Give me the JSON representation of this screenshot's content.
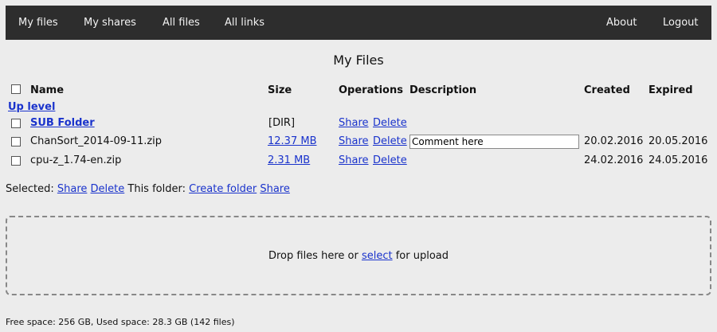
{
  "nav": {
    "left": [
      {
        "label": "My files"
      },
      {
        "label": "My shares"
      },
      {
        "label": "All files"
      },
      {
        "label": "All links"
      }
    ],
    "right": [
      {
        "label": "About"
      },
      {
        "label": "Logout"
      }
    ]
  },
  "title": "My Files",
  "table": {
    "headers": {
      "name": "Name",
      "size": "Size",
      "operations": "Operations",
      "description": "Description",
      "created": "Created",
      "expired": "Expired"
    },
    "up_level": "Up level",
    "rows": [
      {
        "name": "SUB Folder",
        "size": "[DIR]",
        "share": "Share",
        "delete": "Delete",
        "description": "",
        "created": "",
        "expired": ""
      },
      {
        "name": "ChanSort_2014-09-11.zip",
        "size": "12.37 MB",
        "share": "Share",
        "delete": "Delete",
        "description": "Comment here",
        "created": "20.02.2016",
        "expired": "20.05.2016"
      },
      {
        "name": "cpu-z_1.74-en.zip",
        "size": "2.31 MB",
        "share": "Share",
        "delete": "Delete",
        "description": "",
        "created": "24.02.2016",
        "expired": "24.05.2016"
      }
    ]
  },
  "actions": {
    "selected_label": "Selected:",
    "share": "Share",
    "delete": "Delete",
    "folder_label": "This folder:",
    "create_folder": "Create folder",
    "folder_share": "Share"
  },
  "upload": {
    "before": "Drop files here or",
    "select": "select",
    "after": "for upload"
  },
  "footer": "Free space: 256 GB, Used space: 28.3 GB (142 files)"
}
